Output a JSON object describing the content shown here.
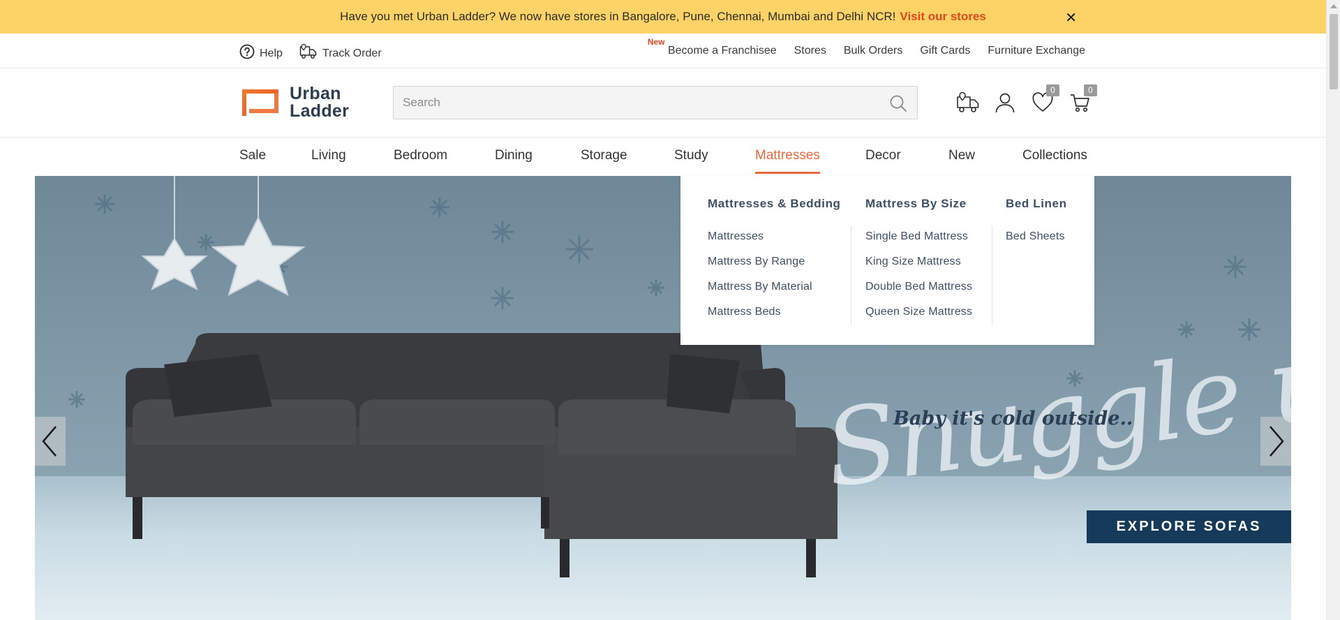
{
  "announcement": {
    "text": "Have you met Urban Ladder? We now have stores in Bangalore, Pune, Chennai, Mumbai and Delhi NCR!",
    "link": "Visit our stores",
    "close": "✕"
  },
  "utility": {
    "help": "Help",
    "track_order": "Track Order",
    "new_badge": "New",
    "links": [
      "Become a Franchisee",
      "Stores",
      "Bulk Orders",
      "Gift Cards",
      "Furniture Exchange"
    ]
  },
  "header": {
    "logo_line1": "Urban",
    "logo_line2": "Ladder",
    "search_placeholder": "Search",
    "wishlist_count": "0",
    "cart_count": "0"
  },
  "nav": {
    "categories": [
      "Sale",
      "Living",
      "Bedroom",
      "Dining",
      "Storage",
      "Study",
      "Mattresses",
      "Decor",
      "New",
      "Collections"
    ],
    "active": "Mattresses"
  },
  "mega_menu": {
    "columns": [
      {
        "title": "Mattresses & Bedding",
        "items": [
          "Mattresses",
          "Mattress By Range",
          "Mattress By Material",
          "Mattress Beds"
        ]
      },
      {
        "title": "Mattress By Size",
        "items": [
          "Single Bed Mattress",
          "King Size Mattress",
          "Double Bed Mattress",
          "Queen Size Mattress"
        ]
      },
      {
        "title": "Bed Linen",
        "items": [
          "Bed Sheets"
        ]
      }
    ]
  },
  "hero": {
    "tagline": "Baby it's cold outside..",
    "script_text": "Snuggle up",
    "cta": "EXPLORE SOFAS"
  },
  "colors": {
    "announcement_bg": "#fdd267",
    "accent": "#e9693a",
    "cta_bg": "#163a59",
    "menu_text": "#3c4f66"
  }
}
